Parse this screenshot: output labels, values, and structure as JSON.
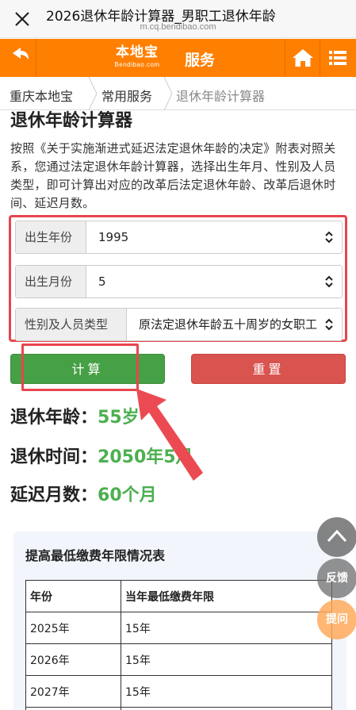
{
  "browser": {
    "title": "2026退休年龄计算器_男职工退休年龄",
    "url": "m.cq.bendibao.com"
  },
  "nav": {
    "logo_main": "本地宝",
    "logo_sub": "Bendibao.com",
    "service_label": "服务",
    "accent_color": "#ff7f00"
  },
  "breadcrumb": {
    "items": [
      "重庆本地宝",
      "常用服务",
      "退休年龄计算器"
    ]
  },
  "page": {
    "title": "退休年龄计算器",
    "description": "按照《关于实施渐进式延迟法定退休年龄的决定》附表对照关系，您通过法定退休年龄计算器，选择出生年月、性别及人员类型，即可计算出对应的改革后法定退休年龄、改革后退休时间、延迟月数。"
  },
  "form": {
    "birth_year_label": "出生年份",
    "birth_year_value": "1995",
    "birth_month_label": "出生月份",
    "birth_month_value": "5",
    "type_label": "性别及人员类型",
    "type_value": "原法定退休年龄五十周岁的女职工"
  },
  "buttons": {
    "calc_label": "计算",
    "reset_label": "重置"
  },
  "results": {
    "age_label": "退休年龄：",
    "age_value": "55岁",
    "time_label": "退休时间：",
    "time_value": "2050年5月",
    "delay_label": "延迟月数：",
    "delay_value": "60个月"
  },
  "table_card": {
    "title": "提高最低缴费年限情况表",
    "headers": [
      "年份",
      "当年最低缴费年限"
    ],
    "rows": [
      [
        "2025年",
        "15年"
      ],
      [
        "2026年",
        "15年"
      ],
      [
        "2027年",
        "15年"
      ]
    ]
  },
  "floating": {
    "feedback": "反馈",
    "ask": "提问"
  },
  "icons": {
    "close": "close-icon",
    "more": "more-icon",
    "back": "back-arrow-icon",
    "home": "home-icon",
    "menu": "list-menu-icon",
    "select_arrow": "select-updown-icon",
    "scroll_up": "chevron-up-icon"
  }
}
